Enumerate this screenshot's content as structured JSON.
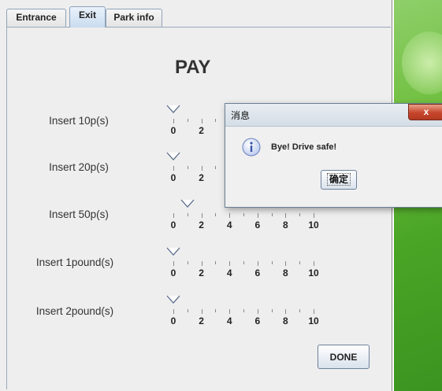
{
  "tabs": [
    "Entrance",
    "Exit",
    "Park info"
  ],
  "active_tab": "Exit",
  "page_title": "PAY",
  "rows": [
    {
      "label": "Insert 10p(s)",
      "value": 0
    },
    {
      "label": "Insert 20p(s)",
      "value": 0
    },
    {
      "label": "Insert 50p(s)",
      "value": 1
    },
    {
      "label": "Insert 1pound(s)",
      "value": 0
    },
    {
      "label": "Insert 2pound(s)",
      "value": 0
    }
  ],
  "slider_labels": [
    "0",
    "2",
    "4",
    "6",
    "8",
    "10"
  ],
  "done_label": "DONE",
  "dialog": {
    "title": "消息",
    "close_label": "x",
    "message": "Bye! Drive safe!",
    "ok_label": "确定",
    "icon": "info-icon"
  },
  "colors": {
    "desktop_green": "#4aa526",
    "close_red": "#c6452b",
    "active_tab": "#c9dcef"
  }
}
